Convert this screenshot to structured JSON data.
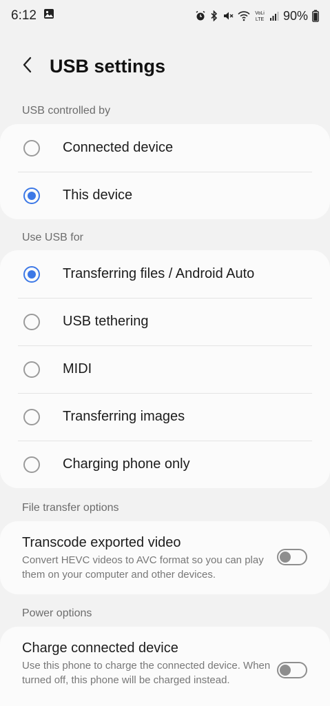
{
  "status_bar": {
    "time": "6:12",
    "battery": "90%",
    "icons": [
      "gallery-icon",
      "alarm-icon",
      "bluetooth-icon",
      "mute-icon",
      "wifi-icon",
      "volte-icon",
      "signal-icon",
      "battery-icon"
    ]
  },
  "header": {
    "title": "USB settings",
    "back_icon": "back-arrow-icon"
  },
  "sections": {
    "controlled_by": {
      "label": "USB controlled by",
      "options": [
        {
          "label": "Connected device",
          "selected": false
        },
        {
          "label": "This device",
          "selected": true
        }
      ]
    },
    "use_usb_for": {
      "label": "Use USB for",
      "options": [
        {
          "label": "Transferring files / Android Auto",
          "selected": true
        },
        {
          "label": "USB tethering",
          "selected": false
        },
        {
          "label": "MIDI",
          "selected": false
        },
        {
          "label": "Transferring images",
          "selected": false
        },
        {
          "label": "Charging phone only",
          "selected": false
        }
      ]
    },
    "file_transfer": {
      "label": "File transfer options",
      "title": "Transcode exported video",
      "description": "Convert HEVC videos to AVC format so you can play them on your computer and other devices.",
      "enabled": false
    },
    "power": {
      "label": "Power options",
      "title": "Charge connected device",
      "description": "Use this phone to charge the connected device. When turned off, this phone will be charged instead.",
      "enabled": false
    }
  },
  "colors": {
    "accent": "#3c78e6",
    "background": "#f2f2f2",
    "card": "#fbfbfb"
  }
}
